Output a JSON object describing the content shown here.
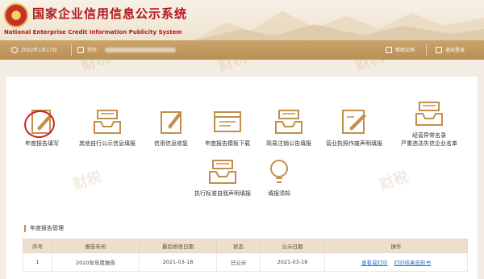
{
  "header": {
    "title_cn": "国家企业信用信息公示系统",
    "title_en": "National Enterprise Credit Information Publicity System"
  },
  "infobar": {
    "date": "2022年1月17日",
    "user_prefix": "您好：",
    "help_label": "帮助文档",
    "logout_label": "退出登录"
  },
  "functions": [
    {
      "label": "年度报告填写",
      "icon": "form-pen-icon"
    },
    {
      "label": "其他自行公示信息填报",
      "icon": "inbox-tray-icon"
    },
    {
      "label": "信用信息修复",
      "icon": "edit-doc-icon"
    },
    {
      "label": "年度报告模板下载",
      "icon": "template-icon"
    },
    {
      "label": "简易注销公告填报",
      "icon": "inbox-tray-icon"
    },
    {
      "label": "营业执照作废声明填报",
      "icon": "license-edit-icon"
    },
    {
      "label": "经营异常名录\n严重违法失信企业名单",
      "icon": "inbox-tray-icon"
    },
    {
      "label": "执行标准自我声明填报",
      "icon": "inbox-tray-icon"
    },
    {
      "label": "填报须知",
      "icon": "lightbulb-icon"
    }
  ],
  "annual_report": {
    "section_title": "年度报告管理",
    "columns": [
      "序号",
      "报告年份",
      "最后修改日期",
      "状态",
      "公示日期",
      "操作"
    ],
    "rows": [
      {
        "index": "1",
        "year": "2020年年度报告",
        "modified": "2021-03-18",
        "status": "已公示",
        "published": "2021-03-18",
        "action_view": "查看或打印",
        "action_print": "打印结果告知书"
      }
    ]
  },
  "watermark": {
    "brand": "财税",
    "sub": "联合联拓"
  },
  "colors": {
    "brand_red": "#b4171b",
    "bar_gold": "#c9a46c",
    "link_blue": "#2c6fc5",
    "highlight_circle": "#d21f1f"
  }
}
